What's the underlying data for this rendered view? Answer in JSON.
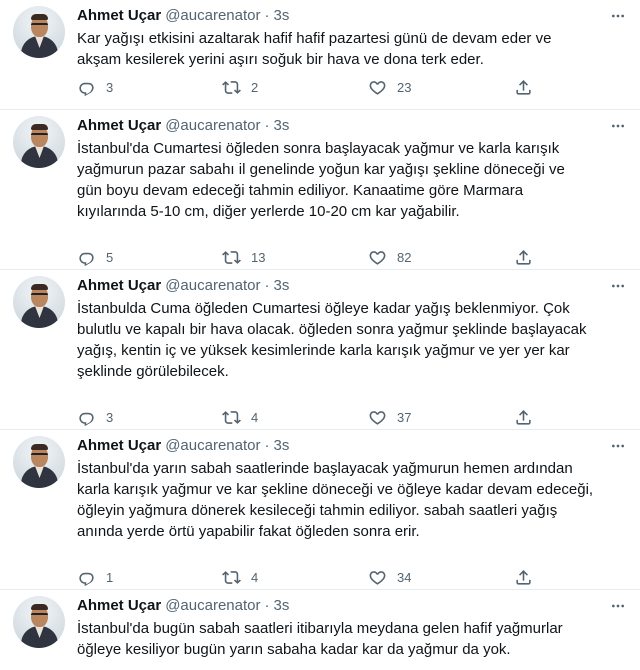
{
  "tweets": [
    {
      "name": "Ahmet Uçar",
      "handle": "@aucarenator",
      "sep": "·",
      "time": "3s",
      "lines": [
        "Kar yağışı etkisini azaltarak hafif hafif pazartesi günü de devam eder ve",
        "akşam kesilerek yerini aşırı soğuk bir hava ve dona terk eder."
      ],
      "replies": "3",
      "retweets": "2",
      "likes": "23"
    },
    {
      "name": "Ahmet Uçar",
      "handle": "@aucarenator",
      "sep": "·",
      "time": "3s",
      "lines": [
        "İstanbul'da Cumartesi öğleden sonra başlayacak yağmur ve karla karışık",
        "yağmurun pazar sabahı il genelinde yoğun kar yağışı şekline döneceği ve",
        "gün boyu devam edeceği tahmin ediliyor. Kanaatime göre Marmara",
        "kıyılarında 5-10 cm,  diğer yerlerde 10-20 cm kar yağabilir."
      ],
      "replies": "5",
      "retweets": "13",
      "likes": "82"
    },
    {
      "name": "Ahmet Uçar",
      "handle": "@aucarenator",
      "sep": "·",
      "time": "3s",
      "lines": [
        "İstanbulda Cuma öğleden Cumartesi öğleye kadar yağış beklenmiyor. Çok",
        "bulutlu ve kapalı bir hava olacak. öğleden sonra yağmur şeklinde başlayacak",
        "yağış,  kentin iç ve yüksek kesimlerinde karla karışık yağmur ve yer yer kar",
        "şeklinde görülebilecek."
      ],
      "replies": "3",
      "retweets": "4",
      "likes": "37"
    },
    {
      "name": "Ahmet Uçar",
      "handle": "@aucarenator",
      "sep": "·",
      "time": "3s",
      "lines": [
        "İstanbul'da yarın sabah saatlerinde başlayacak yağmurun hemen ardından",
        "karla karışık yağmur ve kar şekline döneceği ve öğleye kadar devam edeceği,",
        "öğleyin yağmura dönerek kesileceği tahmin ediliyor. sabah saatleri yağış",
        "anında yerde örtü yapabilir fakat öğleden sonra erir."
      ],
      "replies": "1",
      "retweets": "4",
      "likes": "34"
    },
    {
      "name": "Ahmet Uçar",
      "handle": "@aucarenator",
      "sep": "·",
      "time": "3s",
      "lines": [
        "İstanbul'da bugün sabah saatleri itibarıyla meydana gelen hafif yağmurlar",
        "öğleye kesiliyor bugün yarın sabaha kadar kar da yağmur da yok."
      ]
    }
  ]
}
